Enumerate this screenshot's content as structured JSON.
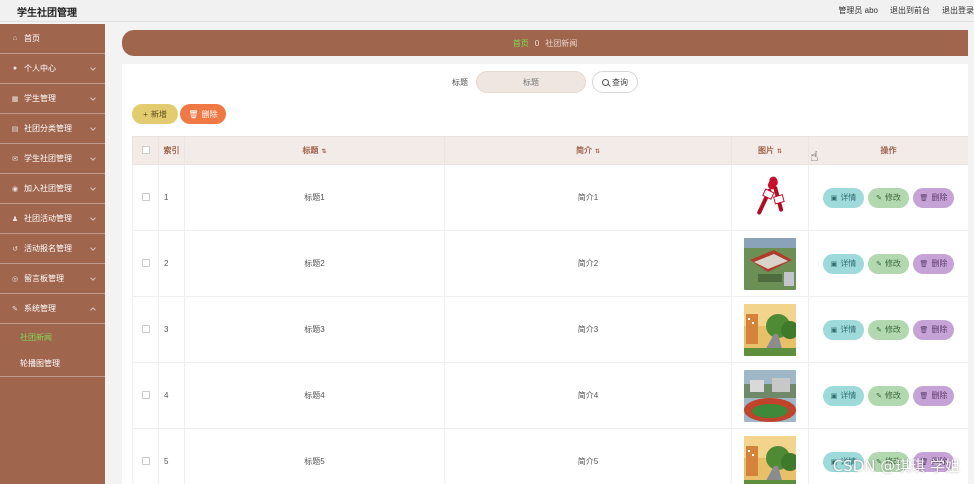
{
  "app": {
    "title": "学生社团管理"
  },
  "topbar": {
    "admin_text": "管理员 abo",
    "back_to_front": "退出到前台",
    "logout": "退出登录"
  },
  "sidebar": {
    "items": [
      {
        "label": "首页",
        "icon": "home-icon"
      },
      {
        "label": "个人中心",
        "icon": "user-icon"
      },
      {
        "label": "学生管理",
        "icon": "student-icon"
      },
      {
        "label": "社团分类管理",
        "icon": "category-icon"
      },
      {
        "label": "学生社团管理",
        "icon": "club-icon"
      },
      {
        "label": "加入社团管理",
        "icon": "join-icon"
      },
      {
        "label": "社团活动管理",
        "icon": "activity-icon"
      },
      {
        "label": "活动报名管理",
        "icon": "signup-icon"
      },
      {
        "label": "留言板管理",
        "icon": "message-icon"
      },
      {
        "label": "系统管理",
        "icon": "system-icon"
      }
    ],
    "sub_items": [
      {
        "label": "社团新闻",
        "active": true
      },
      {
        "label": "轮播图管理",
        "active": false
      }
    ]
  },
  "breadcrumb": {
    "home": "首页",
    "separator": "0",
    "current": "社团新闻"
  },
  "search": {
    "label": "标题",
    "placeholder": "标题",
    "button": "查询"
  },
  "actions": {
    "add": "新增",
    "delete": "删除"
  },
  "table": {
    "headers": {
      "index": "索引",
      "title": "标题",
      "intro": "简介",
      "image": "图片",
      "ops": "操作"
    },
    "rows": [
      {
        "index": "1",
        "title": "标题1",
        "intro": "简介1",
        "image": "microphone"
      },
      {
        "index": "2",
        "title": "标题2",
        "intro": "简介2",
        "image": "campus-aerial"
      },
      {
        "index": "3",
        "title": "标题3",
        "intro": "简介3",
        "image": "campus-road"
      },
      {
        "index": "4",
        "title": "标题4",
        "intro": "简介4",
        "image": "campus-track"
      },
      {
        "index": "5",
        "title": "标题5",
        "intro": "简介5",
        "image": "campus-road"
      }
    ],
    "op_labels": {
      "detail": "详情",
      "edit": "修改",
      "delete": "删除"
    }
  },
  "watermark": "CSDN @琪琪 学姐",
  "colors": {
    "sidebar": "#a0654d",
    "accent_green": "#7ed957",
    "add": "#e3cb70",
    "delete": "#f07844",
    "detail": "#9fdadb",
    "edit": "#b2d8b0",
    "op_delete": "#c6a3d6"
  }
}
